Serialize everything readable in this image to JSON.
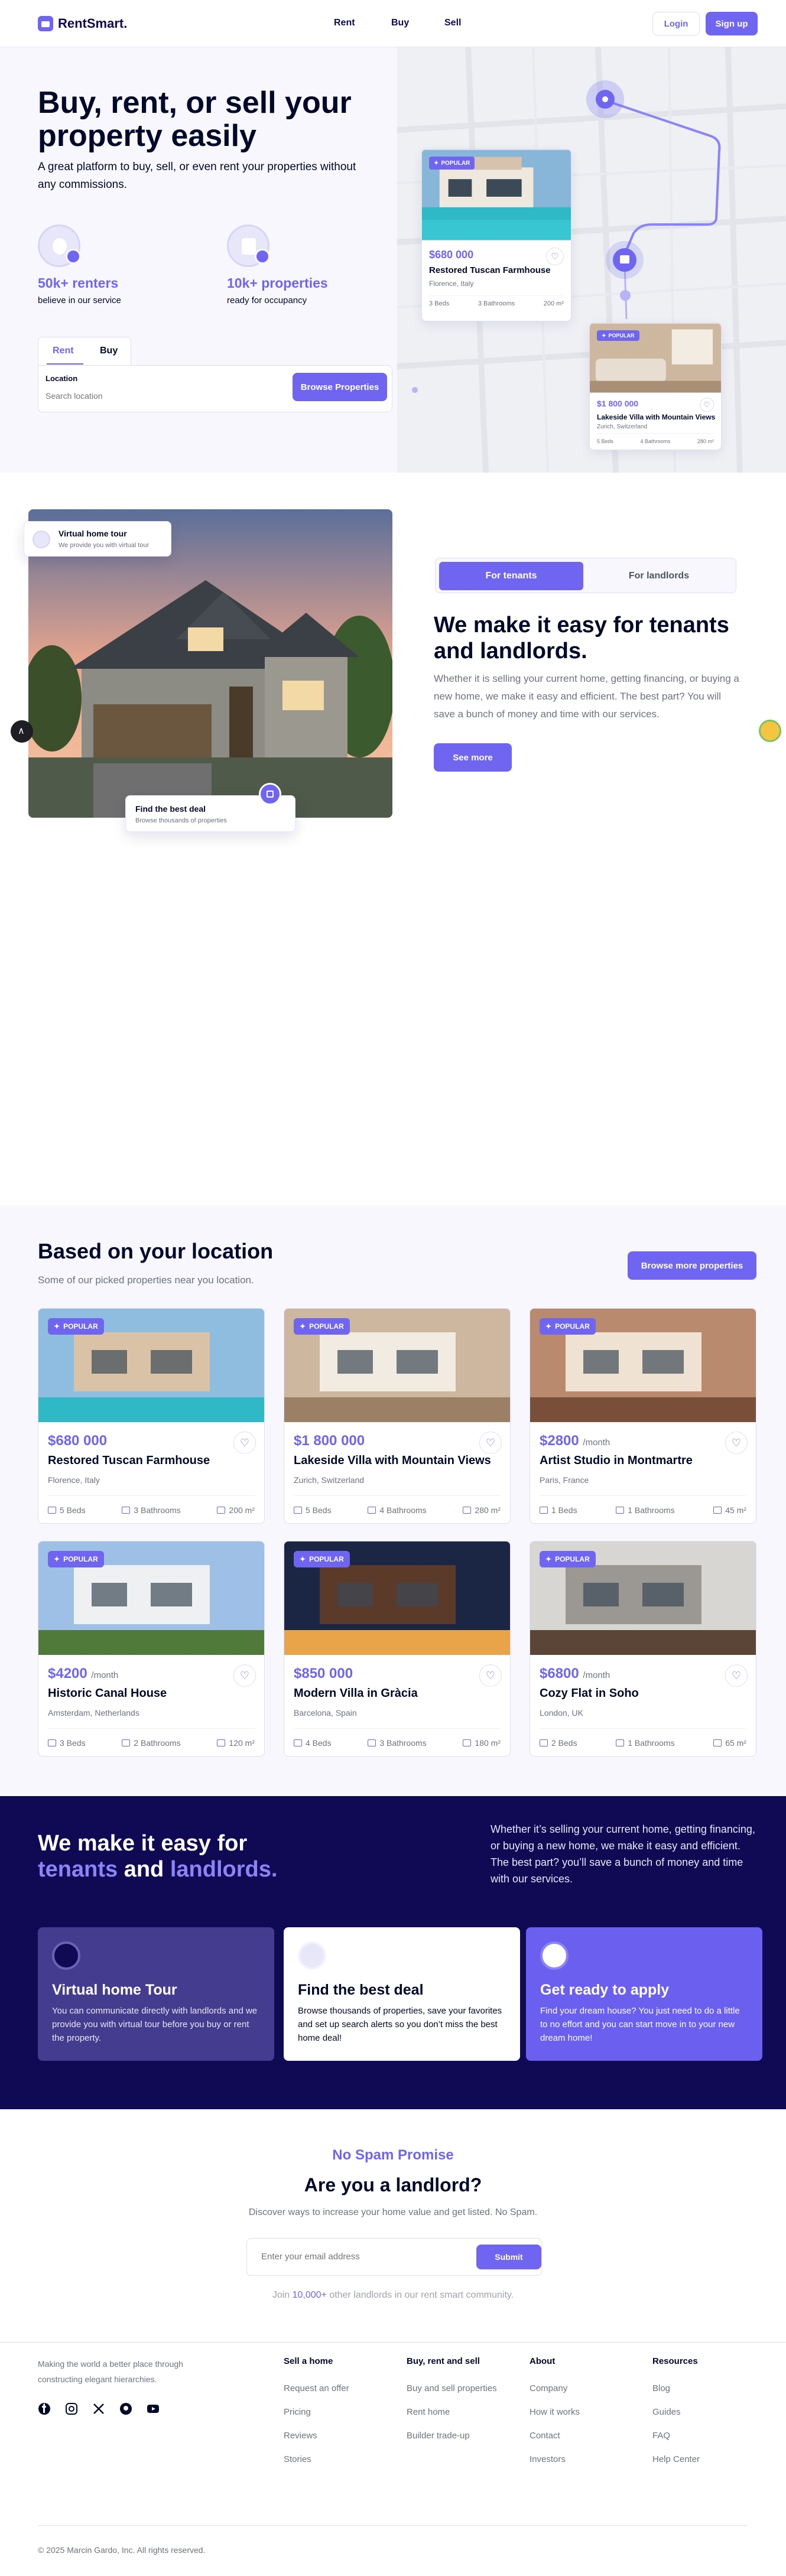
{
  "header": {
    "logo_text": "RentSmart.",
    "nav": [
      "Rent",
      "Buy",
      "Sell"
    ],
    "login_label": "Login",
    "signup_label": "Sign up"
  },
  "hero": {
    "title": "Buy, rent, or sell your property easily",
    "subtitle": "A great platform to buy, sell, or even rent your properties without any commissions.",
    "stats": [
      {
        "value": "50k+ renters",
        "label": "believe in our service",
        "icon": "users-icon"
      },
      {
        "value": "10k+ properties",
        "label": "ready for occupancy",
        "icon": "building-icon"
      }
    ],
    "tabs": [
      "Rent",
      "Buy"
    ],
    "active_tab": "Rent",
    "search": {
      "label": "Location",
      "placeholder": "Search location",
      "button": "Browse Properties"
    },
    "map_cards": [
      {
        "badge": "POPULAR",
        "price": "$680 000",
        "name": "Restored Tuscan Farmhouse",
        "location": "Florence, Italy",
        "beds": "3 Beds",
        "baths": "3 Bathrooms",
        "area": "200 m²"
      },
      {
        "badge": "POPULAR",
        "price": "$1 800 000",
        "name": "Lakeside Villa with Mountain Views",
        "location": "Zurich, Switzerland",
        "beds": "5 Beds",
        "baths": "4 Bathrooms",
        "area": "280 m²"
      }
    ]
  },
  "tenants": {
    "float_top": {
      "title": "Virtual home tour",
      "sub": "We provide you with virtual tour"
    },
    "float_bottom": {
      "title": "Find the best deal",
      "sub": "Browse thousands of properties"
    },
    "toggle": [
      "For tenants",
      "For landlords"
    ],
    "title": "We make it easy for tenants and landlords.",
    "text": "Whether it is selling your current home, getting financing, or buying a new home, we make it easy and efficient. The best part? You will save a bunch of money and time with our services.",
    "button": "See more"
  },
  "listings": {
    "title": "Based on your location",
    "subtitle": "Some of our picked properties near you location.",
    "button": "Browse more properties",
    "badge": "POPULAR",
    "items": [
      {
        "price": "$680 000",
        "per": "",
        "name": "Restored Tuscan Farmhouse",
        "location": "Florence, Italy",
        "beds": "5 Beds",
        "baths": "3 Bathrooms",
        "area": "200 m²"
      },
      {
        "price": "$1 800 000",
        "per": "",
        "name": "Lakeside Villa with Mountain Views",
        "location": "Zurich, Switzerland",
        "beds": "5 Beds",
        "baths": "4 Bathrooms",
        "area": "280 m²"
      },
      {
        "price": "$2800",
        "per": "/month",
        "name": "Artist Studio in Montmartre",
        "location": "Paris, France",
        "beds": "1 Beds",
        "baths": "1 Bathrooms",
        "area": "45 m²"
      },
      {
        "price": "$4200",
        "per": "/month",
        "name": "Historic Canal House",
        "location": "Amsterdam, Netherlands",
        "beds": "3 Beds",
        "baths": "2 Bathrooms",
        "area": "120 m²"
      },
      {
        "price": "$850 000",
        "per": "",
        "name": "Modern Villa in Gràcia",
        "location": "Barcelona, Spain",
        "beds": "4 Beds",
        "baths": "3 Bathrooms",
        "area": "180 m²"
      },
      {
        "price": "$6800",
        "per": "/month",
        "name": "Cozy Flat in Soho",
        "location": "London, UK",
        "beds": "2 Beds",
        "baths": "1 Bathrooms",
        "area": "65 m²"
      }
    ]
  },
  "features": {
    "title_line1": "We make it easy for",
    "title_hl1": "tenants",
    "title_and": " and ",
    "title_hl2": "landlords.",
    "text": "Whether it’s selling your current home, getting financing, or buying a new home, we make it easy and efficient. The best part? you’ll save a bunch of money and time with our services.",
    "cards": [
      {
        "title": "Virtual home Tour",
        "text": "You can communicate directly with landlords and we provide you with virtual tour before you buy or rent the property."
      },
      {
        "title": "Find the best deal",
        "text": "Browse thousands of properties, save your favorites and set up search alerts so you don’t miss the best home deal!"
      },
      {
        "title": "Get ready to apply",
        "text": "Find your dream house? You just need to do a little to no effort and you can start move in to your new dream home!"
      }
    ]
  },
  "landlord": {
    "kicker": "No Spam Promise",
    "title": "Are you a landlord?",
    "subtitle": "Discover ways to increase your home value and get listed. No Spam.",
    "email_placeholder": "Enter your email address",
    "submit": "Submit",
    "join_prefix": "Join ",
    "join_count": "10,000+",
    "join_suffix": " other landlords in our rent smart community."
  },
  "footer": {
    "description": "Making the world a better place through constructing elegant hierarchies.",
    "columns": [
      {
        "title": "Sell a home",
        "links": [
          "Request an offer",
          "Pricing",
          "Reviews",
          "Stories"
        ]
      },
      {
        "title": "Buy, rent and sell",
        "links": [
          "Buy and sell properties",
          "Rent home",
          "Builder trade-up"
        ]
      },
      {
        "title": "About",
        "links": [
          "Company",
          "How it works",
          "Contact",
          "Investors"
        ]
      },
      {
        "title": "Resources",
        "links": [
          "Blog",
          "Guides",
          "FAQ",
          "Help Center"
        ]
      }
    ],
    "copyright": "© 2025 Marcin Gardo, Inc. All rights reserved."
  },
  "colors": {
    "accent": "#7065f0",
    "dark": "#100a55",
    "text": "#000929",
    "muted": "#6c727f"
  }
}
